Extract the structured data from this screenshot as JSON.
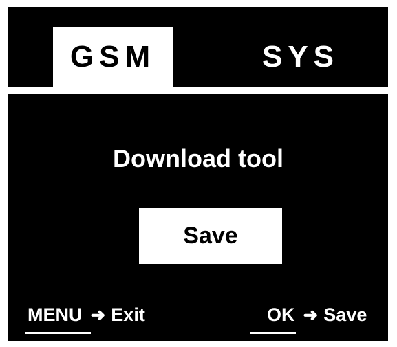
{
  "tabs": [
    {
      "label": "GSM",
      "active": true
    },
    {
      "label": "SYS",
      "active": false
    }
  ],
  "screen": {
    "title": "Download tool",
    "save_button": "Save"
  },
  "hints": {
    "menu_key": "MENU",
    "menu_action": "Exit",
    "ok_key": "OK",
    "ok_action": "Save"
  },
  "colors": {
    "background": "#000000",
    "foreground": "#ffffff"
  }
}
